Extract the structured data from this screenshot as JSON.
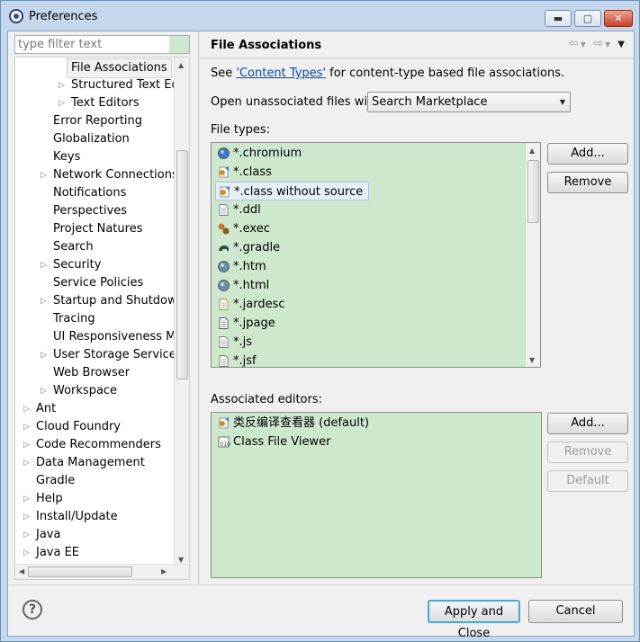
{
  "window": {
    "title": "Preferences",
    "minimize": "▬",
    "maximize": "▢",
    "close": "✕"
  },
  "filter": {
    "placeholder": "type filter text"
  },
  "tree": [
    {
      "label": "File Associations",
      "indent": 3,
      "arrow": "",
      "selected": true
    },
    {
      "label": "Structured Text Edit",
      "indent": 3,
      "arrow": "▷"
    },
    {
      "label": "Text Editors",
      "indent": 3,
      "arrow": "▷"
    },
    {
      "label": "Error Reporting",
      "indent": 2,
      "arrow": ""
    },
    {
      "label": "Globalization",
      "indent": 2,
      "arrow": ""
    },
    {
      "label": "Keys",
      "indent": 2,
      "arrow": ""
    },
    {
      "label": "Network Connections",
      "indent": 2,
      "arrow": "▷"
    },
    {
      "label": "Notifications",
      "indent": 2,
      "arrow": ""
    },
    {
      "label": "Perspectives",
      "indent": 2,
      "arrow": ""
    },
    {
      "label": "Project Natures",
      "indent": 2,
      "arrow": ""
    },
    {
      "label": "Search",
      "indent": 2,
      "arrow": ""
    },
    {
      "label": "Security",
      "indent": 2,
      "arrow": "▷"
    },
    {
      "label": "Service Policies",
      "indent": 2,
      "arrow": ""
    },
    {
      "label": "Startup and Shutdown",
      "indent": 2,
      "arrow": "▷"
    },
    {
      "label": "Tracing",
      "indent": 2,
      "arrow": ""
    },
    {
      "label": "UI Responsiveness Mo",
      "indent": 2,
      "arrow": ""
    },
    {
      "label": "User Storage Service",
      "indent": 2,
      "arrow": "▷"
    },
    {
      "label": "Web Browser",
      "indent": 2,
      "arrow": ""
    },
    {
      "label": "Workspace",
      "indent": 2,
      "arrow": "▷"
    },
    {
      "label": "Ant",
      "indent": 1,
      "arrow": "▷"
    },
    {
      "label": "Cloud Foundry",
      "indent": 1,
      "arrow": "▷"
    },
    {
      "label": "Code Recommenders",
      "indent": 1,
      "arrow": "▷"
    },
    {
      "label": "Data Management",
      "indent": 1,
      "arrow": "▷"
    },
    {
      "label": "Gradle",
      "indent": 1,
      "arrow": ""
    },
    {
      "label": "Help",
      "indent": 1,
      "arrow": "▷"
    },
    {
      "label": "Install/Update",
      "indent": 1,
      "arrow": "▷"
    },
    {
      "label": "Java",
      "indent": 1,
      "arrow": "▷"
    },
    {
      "label": "Java EE",
      "indent": 1,
      "arrow": "▷"
    }
  ],
  "page": {
    "title": "File Associations",
    "see_prefix": "See ",
    "see_link": "'Content Types'",
    "see_suffix": " for content-type based file associations.",
    "open_label": "Open unassociated files with:",
    "open_value": "Search Marketplace",
    "file_types_label": "File types:",
    "associated_label": "Associated editors:"
  },
  "file_types": [
    {
      "label": "*.chromium",
      "icon": "chromium-icon",
      "color": "#3c78c8"
    },
    {
      "label": "*.class",
      "icon": "class-file-icon",
      "color": "#d28a2a"
    },
    {
      "label": "*.class without source",
      "icon": "class-file-icon",
      "color": "#d28a2a",
      "selected": true
    },
    {
      "label": "*.ddl",
      "icon": "ddl-file-icon",
      "color": "#6a7b8c"
    },
    {
      "label": "*.exec",
      "icon": "gears-icon",
      "color": "#c07a2a"
    },
    {
      "label": "*.gradle",
      "icon": "gradle-elephant-icon",
      "color": "#2d4a3a"
    },
    {
      "label": "*.htm",
      "icon": "globe-icon",
      "color": "#6a8fa8"
    },
    {
      "label": "*.html",
      "icon": "globe-icon",
      "color": "#6a8fa8"
    },
    {
      "label": "*.jardesc",
      "icon": "jardesc-icon",
      "color": "#b08a3a"
    },
    {
      "label": "*.jpage",
      "icon": "jpage-icon",
      "color": "#555555"
    },
    {
      "label": "*.js",
      "icon": "js-file-icon",
      "color": "#777777"
    },
    {
      "label": "*.jsf",
      "icon": "jsf-file-icon",
      "color": "#777777"
    }
  ],
  "editors": [
    {
      "label": "类反编译查看器 (default)",
      "icon": "decompiler-icon",
      "color": "#d28a2a"
    },
    {
      "label": "Class File Viewer",
      "icon": "class-viewer-icon",
      "color": "#444444"
    }
  ],
  "buttons": {
    "add_type": "Add...",
    "remove_type": "Remove",
    "add_editor": "Add...",
    "remove_editor": "Remove",
    "default_editor": "Default",
    "apply_close": "Apply and Close",
    "cancel": "Cancel",
    "help": "?"
  }
}
